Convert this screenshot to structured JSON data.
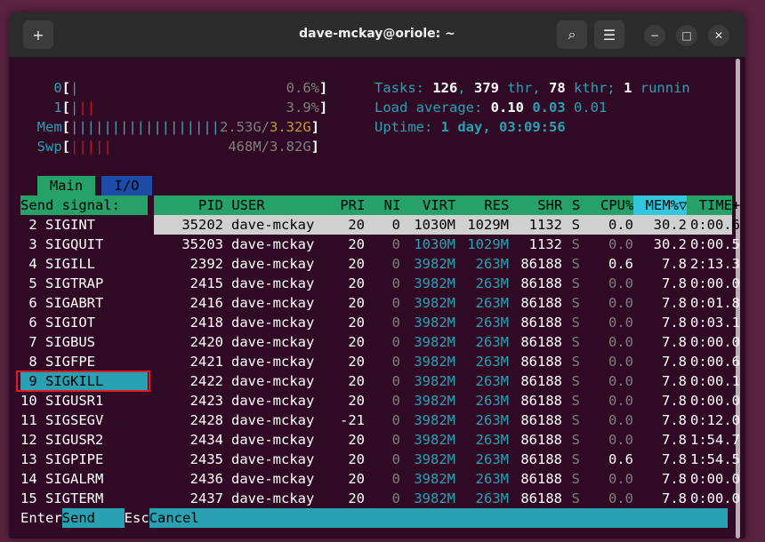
{
  "window": {
    "title": "dave-mckay@oriole: ~",
    "buttons": {
      "new_tab": "+",
      "search": "⌕",
      "menu": "☰",
      "minimize": "−",
      "maximize": "□",
      "close": "✕"
    }
  },
  "meters": {
    "cpu0_label": "0",
    "cpu0_pct": "0.6%",
    "cpu1_label": "1",
    "cpu1_pct": "3.9%",
    "mem_label": "Mem",
    "mem_used": "2.53G",
    "mem_total": "3.32G",
    "swp_label": "Swp",
    "swp_value": "468M/3.82G"
  },
  "summary": {
    "tasks_label": "Tasks:",
    "tasks": "126",
    "thr": "379",
    "thr_label": "thr,",
    "kthr": "78",
    "kthr_label": "kthr;",
    "running": "1",
    "running_label": "runnin",
    "load_label": "Load average:",
    "load1": "0.10",
    "load5": "0.03",
    "load15": "0.01",
    "uptime_label": "Uptime:",
    "uptime": "1 day, 03:09:56"
  },
  "tabs": {
    "main": "Main",
    "io": "I/O"
  },
  "signal_panel": {
    "header": "Send signal:",
    "signals": [
      " 2 SIGINT",
      " 3 SIGQUIT",
      " 4 SIGILL",
      " 5 SIGTRAP",
      " 6 SIGABRT",
      " 6 SIGIOT",
      " 7 SIGBUS",
      " 8 SIGFPE",
      " 9 SIGKILL",
      "10 SIGUSR1",
      "11 SIGSEGV",
      "12 SIGUSR2",
      "13 SIGPIPE",
      "14 SIGALRM",
      "15 SIGTERM"
    ],
    "selected_index": 8
  },
  "process_table": {
    "headers": {
      "pid": "PID",
      "user": "USER",
      "pri": "PRI",
      "ni": "NI",
      "virt": "VIRT",
      "res": "RES",
      "shr": "SHR",
      "s": "S",
      "cpu": "CPU%",
      "mem": "MEM%▽",
      "time": "TIME+"
    },
    "rows": [
      {
        "pid": "35202",
        "user": "dave-mckay",
        "pri": "20",
        "ni": "0",
        "virt": "1030M",
        "res": "1029M",
        "shr": "1132",
        "s": "S",
        "cpu": "0.0",
        "mem": "30.2",
        "time": "0:00.6"
      },
      {
        "pid": "35203",
        "user": "dave-mckay",
        "pri": "20",
        "ni": "0",
        "virt": "1030M",
        "res": "1029M",
        "shr": "1132",
        "s": "S",
        "cpu": "0.0",
        "mem": "30.2",
        "time": "0:00.5"
      },
      {
        "pid": "2392",
        "user": "dave-mckay",
        "pri": "20",
        "ni": "0",
        "virt": "3982M",
        "res": "263M",
        "shr": "86188",
        "s": "S",
        "cpu": "0.6",
        "mem": "7.8",
        "time": "2:13.3"
      },
      {
        "pid": "2415",
        "user": "dave-mckay",
        "pri": "20",
        "ni": "0",
        "virt": "3982M",
        "res": "263M",
        "shr": "86188",
        "s": "S",
        "cpu": "0.0",
        "mem": "7.8",
        "time": "0:00.0"
      },
      {
        "pid": "2416",
        "user": "dave-mckay",
        "pri": "20",
        "ni": "0",
        "virt": "3982M",
        "res": "263M",
        "shr": "86188",
        "s": "S",
        "cpu": "0.0",
        "mem": "7.8",
        "time": "0:01.8"
      },
      {
        "pid": "2418",
        "user": "dave-mckay",
        "pri": "20",
        "ni": "0",
        "virt": "3982M",
        "res": "263M",
        "shr": "86188",
        "s": "S",
        "cpu": "0.0",
        "mem": "7.8",
        "time": "0:03.1"
      },
      {
        "pid": "2420",
        "user": "dave-mckay",
        "pri": "20",
        "ni": "0",
        "virt": "3982M",
        "res": "263M",
        "shr": "86188",
        "s": "S",
        "cpu": "0.0",
        "mem": "7.8",
        "time": "0:00.0"
      },
      {
        "pid": "2421",
        "user": "dave-mckay",
        "pri": "20",
        "ni": "0",
        "virt": "3982M",
        "res": "263M",
        "shr": "86188",
        "s": "S",
        "cpu": "0.0",
        "mem": "7.8",
        "time": "0:00.6"
      },
      {
        "pid": "2422",
        "user": "dave-mckay",
        "pri": "20",
        "ni": "0",
        "virt": "3982M",
        "res": "263M",
        "shr": "86188",
        "s": "S",
        "cpu": "0.0",
        "mem": "7.8",
        "time": "0:00.1"
      },
      {
        "pid": "2423",
        "user": "dave-mckay",
        "pri": "20",
        "ni": "0",
        "virt": "3982M",
        "res": "263M",
        "shr": "86188",
        "s": "S",
        "cpu": "0.0",
        "mem": "7.8",
        "time": "0:00.0"
      },
      {
        "pid": "2428",
        "user": "dave-mckay",
        "pri": "-21",
        "ni": "0",
        "virt": "3982M",
        "res": "263M",
        "shr": "86188",
        "s": "S",
        "cpu": "0.0",
        "mem": "7.8",
        "time": "0:12.0"
      },
      {
        "pid": "2434",
        "user": "dave-mckay",
        "pri": "20",
        "ni": "0",
        "virt": "3982M",
        "res": "263M",
        "shr": "86188",
        "s": "S",
        "cpu": "0.0",
        "mem": "7.8",
        "time": "1:54.7"
      },
      {
        "pid": "2435",
        "user": "dave-mckay",
        "pri": "20",
        "ni": "0",
        "virt": "3982M",
        "res": "263M",
        "shr": "86188",
        "s": "S",
        "cpu": "0.6",
        "mem": "7.8",
        "time": "1:54.5"
      },
      {
        "pid": "2436",
        "user": "dave-mckay",
        "pri": "20",
        "ni": "0",
        "virt": "3982M",
        "res": "263M",
        "shr": "86188",
        "s": "S",
        "cpu": "0.0",
        "mem": "7.8",
        "time": "0:00.0"
      },
      {
        "pid": "2437",
        "user": "dave-mckay",
        "pri": "20",
        "ni": "0",
        "virt": "3982M",
        "res": "263M",
        "shr": "86188",
        "s": "S",
        "cpu": "0.0",
        "mem": "7.8",
        "time": "0:00.0"
      }
    ],
    "selected_index": 0
  },
  "footer": {
    "enter_key": "Enter",
    "send_label": "Send",
    "esc_key": "Esc",
    "cancel_label": "Cancel"
  }
}
